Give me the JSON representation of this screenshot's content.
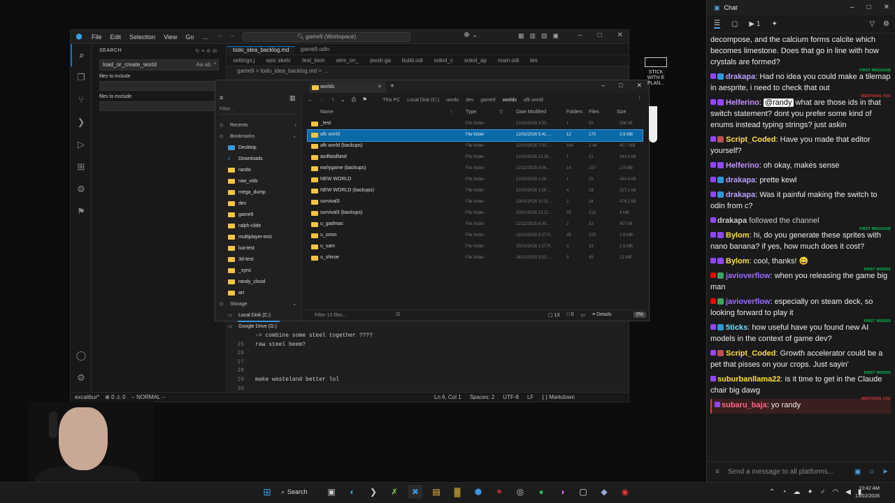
{
  "vscode": {
    "menu": [
      "File",
      "Edit",
      "Selection",
      "View",
      "Go",
      "…"
    ],
    "search_box": "game9 (Workspace)",
    "sidebar_title": "SEARCH",
    "search_query": "load_or_create_world",
    "search_opts": "Aa ab .*",
    "files_to_include": "files to include",
    "files_to_exclude": "files to exclude",
    "tabs1": [
      "todo_idea_backlog.md",
      "game9.odin"
    ],
    "tabs2": [
      "settings.j",
      "epic sketc",
      "test_bion",
      "wire_on_",
      "pwsh ga",
      "build.odi",
      "sokol_c",
      "sokol_ap",
      "main.odi",
      "tes"
    ],
    "breadcrumbs": "game9 > todo_idea_backlog.md > ...",
    "code_lines": [
      {
        "n": "",
        "t": "-> combine some steel together ????"
      },
      {
        "n": "25",
        "t": "raw steel beem?"
      },
      {
        "n": "26",
        "t": ""
      },
      {
        "n": "27",
        "t": ""
      },
      {
        "n": "28",
        "t": ""
      },
      {
        "n": "29",
        "t": "make wasteland better lol"
      },
      {
        "n": "30",
        "t": ""
      }
    ],
    "status_left": [
      "excalibur*",
      "⊗ 0 ⚠ 0",
      "-- NORMAL --"
    ],
    "status_right": [
      "Ln 6, Col 1",
      "Spaces: 2",
      "UTF-8",
      "LF",
      "{ } Markdown"
    ]
  },
  "explorer": {
    "tab_title": "worlds",
    "filter_placeholder": "Filter...",
    "nav": [
      {
        "label": "Recents",
        "type": "section"
      },
      {
        "label": "Bookmarks",
        "type": "section"
      },
      {
        "label": "Desktop",
        "type": "desk"
      },
      {
        "label": "Downloads",
        "type": "dl"
      },
      {
        "label": "rando",
        "type": "folder"
      },
      {
        "label": "raw_vids",
        "type": "folder"
      },
      {
        "label": "mega_dump",
        "type": "folder"
      },
      {
        "label": "dev",
        "type": "folder"
      },
      {
        "label": "game9",
        "type": "folder"
      },
      {
        "label": "ralph-clide",
        "type": "folder"
      },
      {
        "label": "multiplayer-test",
        "type": "folder"
      },
      {
        "label": "lua-test",
        "type": "folder"
      },
      {
        "label": "3d-test",
        "type": "folder"
      },
      {
        "label": "_sync",
        "type": "folder"
      },
      {
        "label": "randy_cloud",
        "type": "folder"
      },
      {
        "label": "art",
        "type": "folder"
      },
      {
        "label": "Storage",
        "type": "section"
      },
      {
        "label": "Local Disk (C:)",
        "type": "drive"
      },
      {
        "label": "Google Drive (G:)",
        "type": "drive"
      }
    ],
    "path": [
      "This PC",
      "Local Disk (C:)",
      "rando",
      "dev",
      "game9",
      "worlds",
      "afk world"
    ],
    "columns": [
      "Name",
      "Type",
      "Date Modified",
      "Folders",
      "Files",
      "Size"
    ],
    "rows": [
      {
        "name": "_test",
        "type": "File folder",
        "date": "12/02/2026 3:33 ...",
        "folders": "1",
        "files": "55",
        "size": "396 kB"
      },
      {
        "name": "afk world",
        "type": "File folder",
        "date": "12/02/2026 5:41 ...",
        "folders": "12",
        "files": "170",
        "size": "2.9 MB"
      },
      {
        "name": "afk world (backups)",
        "type": "File folder",
        "date": "12/02/2026 7:03 ...",
        "folders": "164",
        "files": "2.4K",
        "size": "40.7 MB"
      },
      {
        "name": "asdfasdfasd",
        "type": "File folder",
        "date": "12/02/2026 12:26 ...",
        "folders": "1",
        "files": "21",
        "size": "343.4 kB"
      },
      {
        "name": "earlygame (backups)",
        "type": "File folder",
        "date": "12/12/2025 9:06 ...",
        "folders": "16",
        "files": "167",
        "size": "2.9 MB"
      },
      {
        "name": "NEW WORLD",
        "type": "File folder",
        "date": "12/02/2026 1:28 ...",
        "folders": "1",
        "files": "25",
        "size": "440.4 kB"
      },
      {
        "name": "NEW WORLD (backups)",
        "type": "File folder",
        "date": "12/02/2026 1:28 ...",
        "folders": "4",
        "files": "18",
        "size": "227.1 kB"
      },
      {
        "name": "survival3",
        "type": "File folder",
        "date": "13/01/2026 10:31 ...",
        "folders": "2",
        "files": "24",
        "size": "476.2 kB"
      },
      {
        "name": "survival3 (backups)",
        "type": "File folder",
        "date": "20/01/2026 12:21 ...",
        "folders": "25",
        "files": "213",
        "size": "4 MB"
      },
      {
        "name": "u_gadmas",
        "type": "File folder",
        "date": "22/12/2025 8:35 ...",
        "folders": "2",
        "files": "32",
        "size": "907 kB"
      },
      {
        "name": "u_orion",
        "type": "File folder",
        "date": "19/12/2025 9:27 P...",
        "folders": "49",
        "files": "105",
        "size": "2.9 MB"
      },
      {
        "name": "u_sam",
        "type": "File folder",
        "date": "15/01/2026 1:27 P...",
        "folders": "3",
        "files": "33",
        "size": "1.5 MB"
      },
      {
        "name": "u_shiroe",
        "type": "File folder",
        "date": "24/12/2025 5:53 ...",
        "folders": "3",
        "files": "45",
        "size": "12 MB"
      }
    ],
    "filter_files": "Filter 13 files...",
    "stats": [
      "13",
      "0"
    ],
    "details_label": "Details",
    "percent": "0%"
  },
  "thumb_text": "STICK WITH E PLAN...",
  "chat": {
    "title": "Chat",
    "input_placeholder": "Send a message to all platforms...",
    "messages": [
      {
        "user": "",
        "color": "#eeeeee",
        "text": "decompose, and the calcium forms calcite which becomes limestone. Does that go in line with how crystals are formed?",
        "tag": "",
        "plat": "none",
        "badge": ""
      },
      {
        "user": "drakapa",
        "color": "#b9a0ff",
        "text": ": Had no idea you could make a tilemap in aesprite, i need to check that out",
        "tag": "FIRST MESSAGE",
        "plat": "tw",
        "badge": "#2a9ad6"
      },
      {
        "user": "Helferino",
        "color": "#c792ff",
        "text": ": @randy what are those ids in that switch statement? dont you prefer some kind of enums instead typing strings? just askin",
        "tag": "MENTIONS YOU",
        "plat": "tw",
        "badge": "#9146ff",
        "mention": "@randy"
      },
      {
        "user": "Script_Coded",
        "color": "#ffe033",
        "text": ": Have you made that editor yourself?",
        "tag": "",
        "plat": "tw",
        "badge": "#c05050"
      },
      {
        "user": "Helferino",
        "color": "#c792ff",
        "text": ": oh okay, makes sense",
        "tag": "",
        "plat": "tw",
        "badge": "#9146ff"
      },
      {
        "user": "drakapa",
        "color": "#b9a0ff",
        "text": ": prette kewl",
        "tag": "",
        "plat": "tw",
        "badge": "#2a9ad6"
      },
      {
        "user": "drakapa",
        "color": "#b9a0ff",
        "text": ": Was it painful making the switch to odin from c?",
        "tag": "",
        "plat": "tw",
        "badge": "#2a9ad6"
      },
      {
        "user": "drakapa",
        "color": "#cccccc",
        "text": " followed the channel",
        "tag": "",
        "plat": "tw",
        "badge": "",
        "follow": "true"
      },
      {
        "user": "Bylom",
        "color": "#ffe033",
        "text": ": hi, do you generate these sprites with nano banana? if yes, how much does it cost?",
        "tag": "FIRST MESSAGE",
        "plat": "tw",
        "badge": "#9146ff"
      },
      {
        "user": "Bylom",
        "color": "#ffe033",
        "text": ": cool, thanks! 😀",
        "tag": "",
        "plat": "tw",
        "badge": "#9146ff"
      },
      {
        "user": "javioverflow",
        "color": "#9c6bff",
        "text": ": when you releasing the game big man",
        "tag": "FIRST WORDS",
        "plat": "yt",
        "badge": "#3aa55d"
      },
      {
        "user": "javioverflow",
        "color": "#9c6bff",
        "text": ": especially on steam deck, so looking forward to play it",
        "tag": "",
        "plat": "yt",
        "badge": "#3aa55d"
      },
      {
        "user": "5ticks",
        "color": "#6fe0ff",
        "text": ": how useful have you found new AI models in the context of game dev?",
        "tag": "FIRST WORDS",
        "plat": "tw",
        "badge": "#2a9ad6"
      },
      {
        "user": "Script_Coded",
        "color": "#ffe033",
        "text": ": Growth accelerator could be a pet that pisses on your crops. Just sayin'",
        "tag": "",
        "plat": "tw",
        "badge": "#c05050"
      },
      {
        "user": "suburbanllama22",
        "color": "#ffe033",
        "text": ": is it time to get in the Claude chair big dawg",
        "tag": "FIRST WORDS",
        "plat": "tw",
        "badge": ""
      },
      {
        "user": "subaru_baja",
        "color": "#ff6688",
        "text": ": yo randy",
        "tag": "MENTIONS YOU",
        "plat": "tw",
        "badge": "",
        "mention_row": "true"
      }
    ]
  },
  "taskbar": {
    "search_label": "Search",
    "time": "10:42 AM",
    "date": "13/02/2026"
  }
}
